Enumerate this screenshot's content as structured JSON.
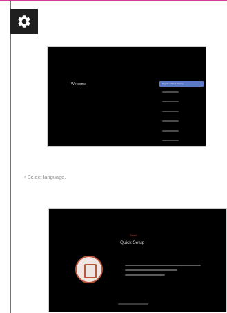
{
  "settings_icon": "gear-icon",
  "screen1": {
    "title": "Welcome",
    "selected_language": "English (United States)"
  },
  "caption": {
    "bullet": "•",
    "text": "Select language."
  },
  "screen2": {
    "brand": "Smart",
    "title": "Quick Setup"
  },
  "colors": {
    "accent_rule": "#d63a9a",
    "selection_blue": "#5c79c4",
    "setup_accent": "#b9543d"
  }
}
